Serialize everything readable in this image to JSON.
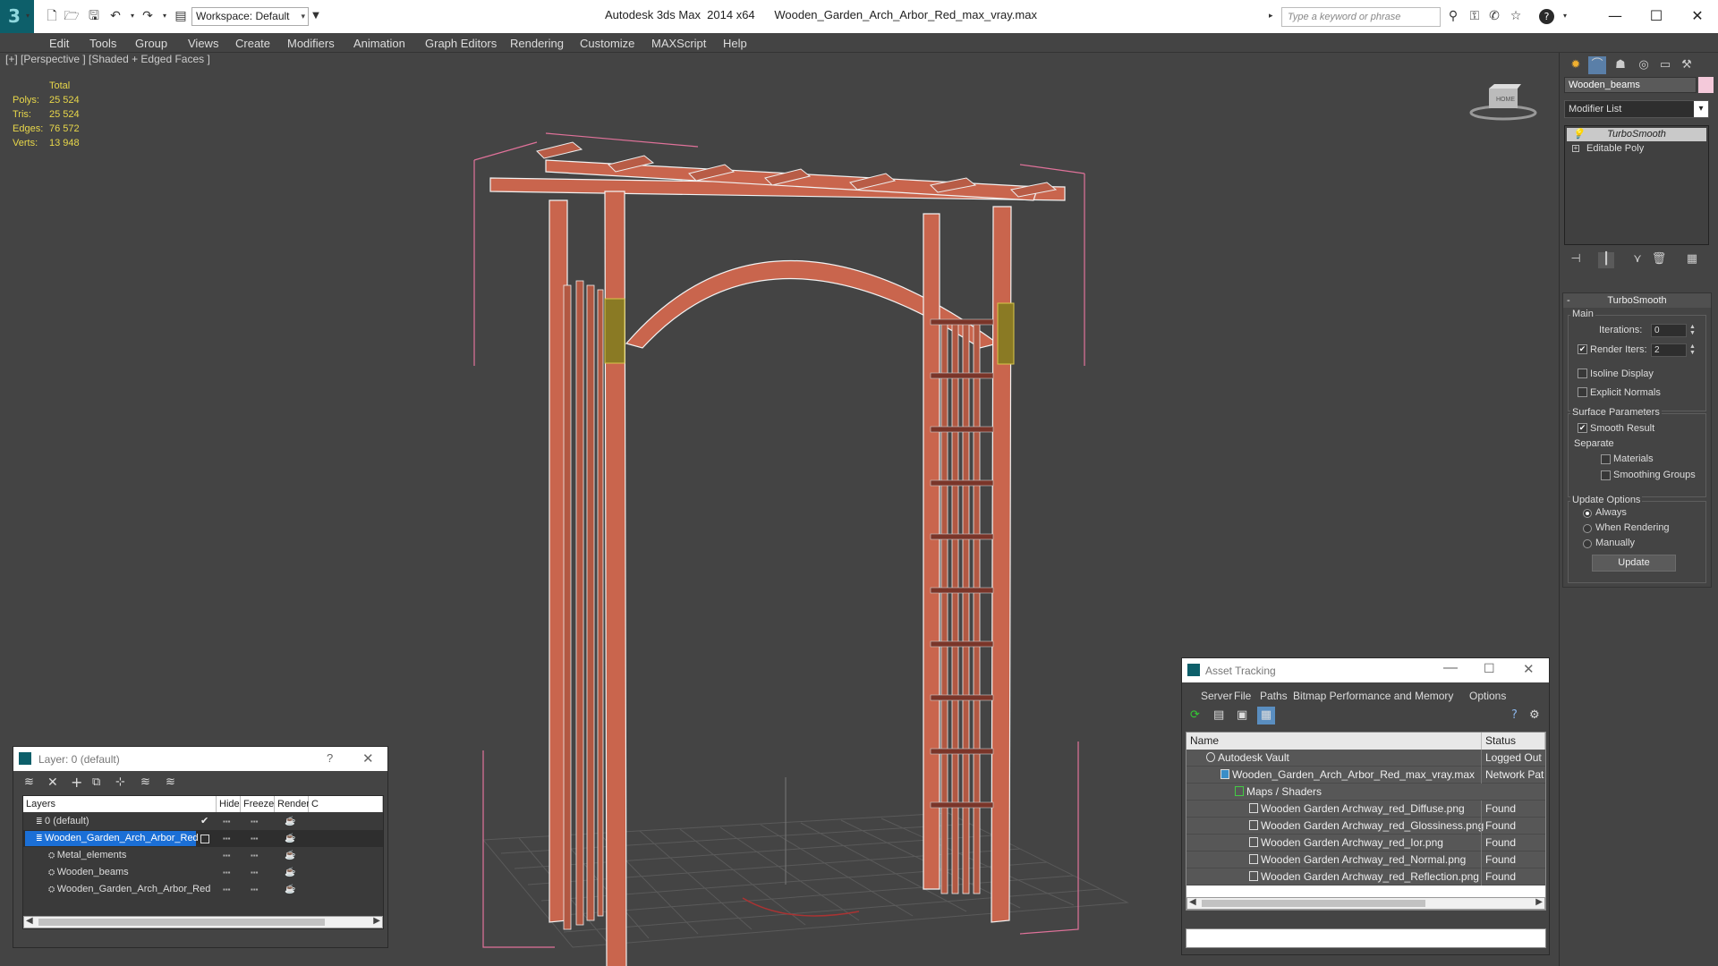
{
  "app": {
    "title_app": "Autodesk 3ds Max  2014 x64",
    "title_file": "Wooden_Garden_Arch_Arbor_Red_max_vray.max",
    "workspace": "Workspace: Default",
    "search_placeholder": "Type a keyword or phrase"
  },
  "menu": [
    "Edit",
    "Tools",
    "Group",
    "Views",
    "Create",
    "Modifiers",
    "Animation",
    "Graph Editors",
    "Rendering",
    "Customize",
    "MAXScript",
    "Help"
  ],
  "viewport": {
    "label": "[+] [Perspective ] [Shaded + Edged Faces ]",
    "stats_header": "Total",
    "stats": [
      {
        "label": "Polys:",
        "value": "25 524"
      },
      {
        "label": "Tris:",
        "value": "25 524"
      },
      {
        "label": "Edges:",
        "value": "76 572"
      },
      {
        "label": "Verts:",
        "value": "13 948"
      }
    ],
    "viewcube_label": "HOME"
  },
  "command_panel": {
    "object_name": "Wooden_beams",
    "object_color": "#f4c9da",
    "modifier_list": "Modifier List",
    "stack": [
      "TurboSmooth",
      "Editable Poly"
    ],
    "rollout_title": "TurboSmooth",
    "main_group": "Main",
    "iterations_label": "Iterations:",
    "iterations_value": "0",
    "render_iters_label": "Render Iters:",
    "render_iters_value": "2",
    "render_iters_checked": true,
    "isoline_display": "Isoline Display",
    "explicit_normals": "Explicit Normals",
    "surface_group": "Surface Parameters",
    "smooth_result": "Smooth Result",
    "separate": "Separate",
    "materials": "Materials",
    "smoothing_groups": "Smoothing Groups",
    "update_group": "Update Options",
    "always": "Always",
    "when_rendering": "When Rendering",
    "manually": "Manually",
    "update_button": "Update"
  },
  "asset_tracking": {
    "title": "Asset Tracking",
    "menu": [
      "Server",
      "File",
      "Paths",
      "Bitmap Performance and Memory",
      "Options"
    ],
    "columns": [
      "Name",
      "Status"
    ],
    "rows": [
      {
        "name": "Autodesk Vault",
        "status": "Logged Out",
        "indent": 0
      },
      {
        "name": "Wooden_Garden_Arch_Arbor_Red_max_vray.max",
        "status": "Network Pat",
        "indent": 1
      },
      {
        "name": "Maps / Shaders",
        "status": "",
        "indent": 2
      },
      {
        "name": "Wooden Garden Archway_red_Diffuse.png",
        "status": "Found",
        "indent": 3
      },
      {
        "name": "Wooden Garden Archway_red_Glossiness.png",
        "status": "Found",
        "indent": 3
      },
      {
        "name": "Wooden Garden Archway_red_Ior.png",
        "status": "Found",
        "indent": 3
      },
      {
        "name": "Wooden Garden Archway_red_Normal.png",
        "status": "Found",
        "indent": 3
      },
      {
        "name": "Wooden Garden Archway_red_Reflection.png",
        "status": "Found",
        "indent": 3
      }
    ]
  },
  "layer_explorer": {
    "title": "Layer: 0 (default)",
    "columns": [
      "Layers",
      "Hide",
      "Freeze",
      "Render",
      "C"
    ],
    "rows": [
      {
        "name": "0 (default)",
        "selected": false,
        "level": 0
      },
      {
        "name": "Wooden_Garden_Arch_Arbor_Red",
        "selected": true,
        "level": 0
      },
      {
        "name": "Metal_elements",
        "selected": false,
        "level": 1
      },
      {
        "name": "Wooden_beams",
        "selected": false,
        "level": 1
      },
      {
        "name": "Wooden_Garden_Arch_Arbor_Red",
        "selected": false,
        "level": 1
      }
    ]
  }
}
